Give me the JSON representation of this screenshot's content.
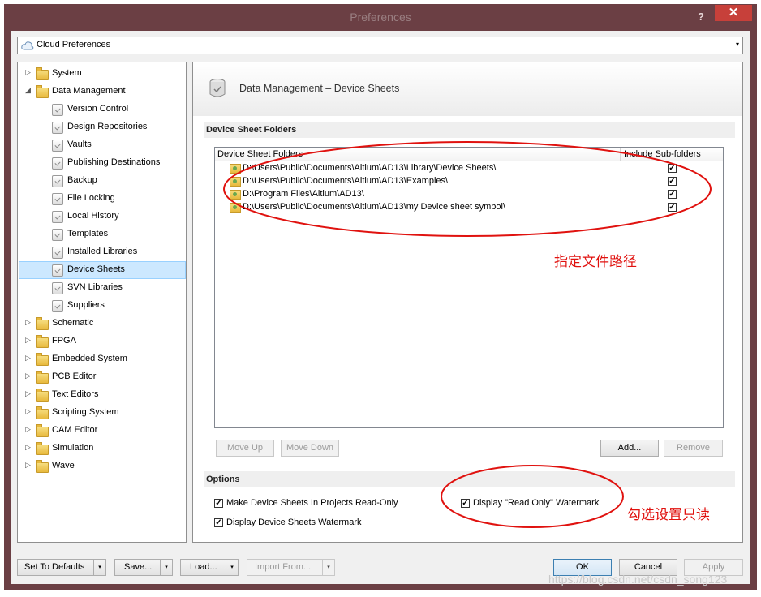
{
  "window": {
    "title": "Preferences",
    "help_glyph": "?",
    "close_glyph": "✕"
  },
  "combo": {
    "value": "Cloud Preferences",
    "arrow": "▾"
  },
  "tree": {
    "items": [
      {
        "label": "System",
        "type": "folder",
        "expander": "▷"
      },
      {
        "label": "Data Management",
        "type": "folder",
        "expander": "◢"
      },
      {
        "label": "Version Control",
        "type": "page"
      },
      {
        "label": "Design Repositories",
        "type": "page"
      },
      {
        "label": "Vaults",
        "type": "page"
      },
      {
        "label": "Publishing Destinations",
        "type": "page"
      },
      {
        "label": "Backup",
        "type": "page"
      },
      {
        "label": "File Locking",
        "type": "page"
      },
      {
        "label": "Local History",
        "type": "page"
      },
      {
        "label": "Templates",
        "type": "page"
      },
      {
        "label": "Installed Libraries",
        "type": "page"
      },
      {
        "label": "Device Sheets",
        "type": "page",
        "selected": true
      },
      {
        "label": "SVN Libraries",
        "type": "page"
      },
      {
        "label": "Suppliers",
        "type": "page"
      },
      {
        "label": "Schematic",
        "type": "folder",
        "expander": "▷"
      },
      {
        "label": "FPGA",
        "type": "folder",
        "expander": "▷"
      },
      {
        "label": "Embedded System",
        "type": "folder",
        "expander": "▷"
      },
      {
        "label": "PCB Editor",
        "type": "folder",
        "expander": "▷"
      },
      {
        "label": "Text Editors",
        "type": "folder",
        "expander": "▷"
      },
      {
        "label": "Scripting System",
        "type": "folder",
        "expander": "▷"
      },
      {
        "label": "CAM Editor",
        "type": "folder",
        "expander": "▷"
      },
      {
        "label": "Simulation",
        "type": "folder",
        "expander": "▷"
      },
      {
        "label": "Wave",
        "type": "folder",
        "expander": "▷"
      }
    ]
  },
  "panel": {
    "title": "Data Management – Device Sheets",
    "folders_section": "Device Sheet Folders",
    "list_header": {
      "col1": "Device Sheet Folders",
      "col2": "Include Sub-folders"
    },
    "rows": [
      {
        "path": "D:\\Users\\Public\\Documents\\Altium\\AD13\\Library\\Device Sheets\\",
        "checked": "✓"
      },
      {
        "path": "D:\\Users\\Public\\Documents\\Altium\\AD13\\Examples\\",
        "checked": "✓"
      },
      {
        "path": "D:\\Program Files\\Altium\\AD13\\",
        "checked": "✓"
      },
      {
        "path": "D:\\Users\\Public\\Documents\\Altium\\AD13\\my Device sheet symbol\\",
        "checked": "✓"
      }
    ],
    "move_up": "Move Up",
    "move_down": "Move Down",
    "add": "Add...",
    "remove": "Remove",
    "options_section": "Options",
    "options": {
      "read_only": {
        "label": "Make Device Sheets In Projects Read-Only",
        "checked": "✓"
      },
      "watermark": {
        "label": "Display Device Sheets Watermark",
        "checked": "✓"
      },
      "read_only_watermark": {
        "label": "Display \"Read Only\" Watermark",
        "checked": "✓"
      }
    }
  },
  "bottom": {
    "set_defaults": "Set To Defaults",
    "save": "Save...",
    "load": "Load...",
    "import_from": "Import From...",
    "ok": "OK",
    "cancel": "Cancel",
    "apply": "Apply",
    "dd": "▾"
  },
  "annotations": {
    "path_note": "指定文件路径",
    "readonly_note": "勾选设置只读",
    "color": "#e0120f"
  },
  "watermark_text": "https://blog.csdn.net/csdn_song123"
}
